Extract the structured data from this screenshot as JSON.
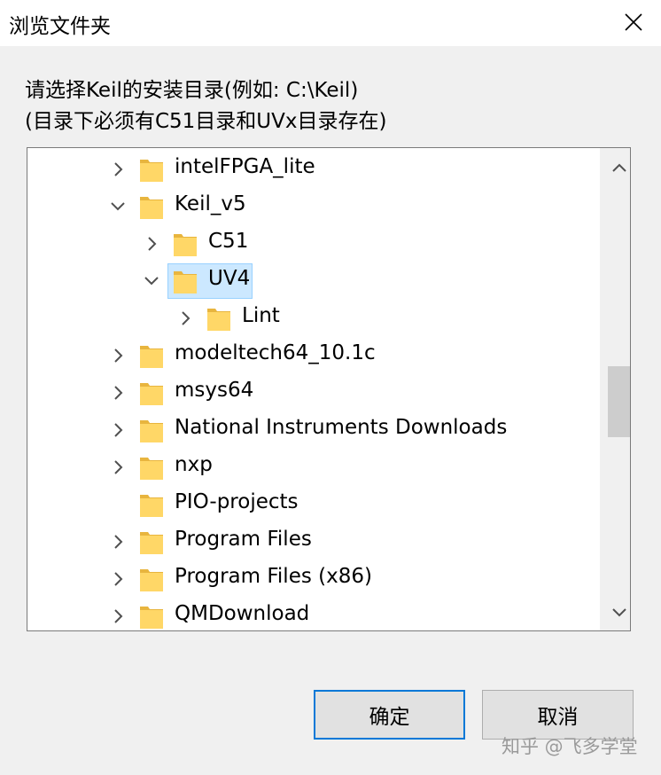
{
  "window": {
    "title": "浏览文件夹"
  },
  "instructions": {
    "line1": "请选择Keil的安装目录(例如: C:\\Keil)",
    "line2": "(目录下必须有C51目录和UVx目录存在)"
  },
  "tree": {
    "items": [
      {
        "label": "intelFPGA_lite",
        "chevron": "right"
      },
      {
        "label": "Keil_v5",
        "chevron": "down"
      },
      {
        "label": "C51",
        "chevron": "right"
      },
      {
        "label": "UV4",
        "chevron": "down",
        "selected": true
      },
      {
        "label": "Lint",
        "chevron": "right"
      },
      {
        "label": "modeltech64_10.1c",
        "chevron": "right"
      },
      {
        "label": "msys64",
        "chevron": "right"
      },
      {
        "label": "National Instruments Downloads",
        "chevron": "right"
      },
      {
        "label": "nxp",
        "chevron": "right"
      },
      {
        "label": "PIO-projects",
        "chevron": "none"
      },
      {
        "label": "Program Files",
        "chevron": "right"
      },
      {
        "label": "Program Files (x86)",
        "chevron": "right"
      },
      {
        "label": "QMDownload",
        "chevron": "right"
      }
    ]
  },
  "buttons": {
    "ok": "确定",
    "cancel": "取消"
  },
  "watermark": "知乎 @飞多学堂",
  "icons": {
    "folder": "folder-icon",
    "chevron_right": "chevron-right-icon",
    "chevron_down": "chevron-down-icon",
    "close": "close-icon"
  },
  "colors": {
    "folder": "#ffd767",
    "selection": "#cce8ff",
    "accent": "#0078d7"
  }
}
